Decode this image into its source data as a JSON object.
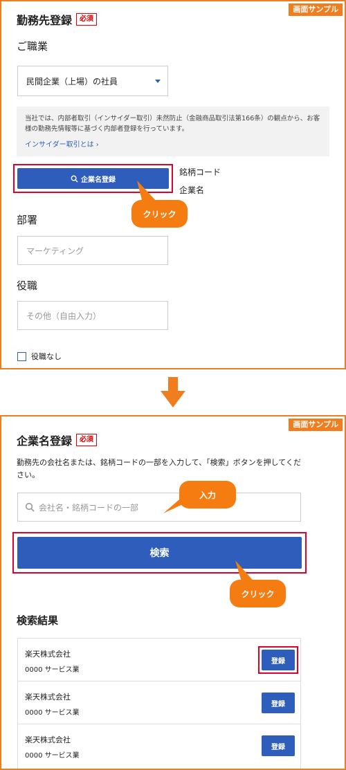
{
  "sample_label": "画面サンプル",
  "screen1": {
    "title": "勤務先登録",
    "required_badge": "必須",
    "occupation_label": "ご職業",
    "occupation_value": "民間企業（上場）の社員",
    "notice_text": "当社では、内部者取引（インサイダー取引）未然防止（金融商品取引法第166条）の観点から、お客様の勤務先情報等に基づく内部者登録を行っています。",
    "notice_link": "インサイダー取引とは",
    "company_register_button": "企業名登録",
    "stock_code_label": "銘柄コード",
    "company_name_label": "企業名",
    "callout_click": "クリック",
    "department_label": "部署",
    "department_placeholder": "マーケティング",
    "position_label": "役職",
    "position_placeholder": "その他（自由入力）",
    "no_position_label": "役職なし"
  },
  "screen2": {
    "title": "企業名登録",
    "required_badge": "必須",
    "instruction": "勤務先の会社名または、銘柄コードの一部を入力して、「検索」ボタンを押してください。",
    "search_placeholder": "会社名・銘柄コードの一部",
    "callout_input": "入力",
    "search_button": "検索",
    "callout_click": "クリック",
    "results_title": "検索結果",
    "results": [
      {
        "name": "楽天株式会社",
        "code": "0000 サービス業",
        "button": "登録"
      },
      {
        "name": "楽天株式会社",
        "code": "0000 サービス業",
        "button": "登録"
      },
      {
        "name": "楽天株式会社",
        "code": "0000 サービス業",
        "button": "登録"
      }
    ]
  },
  "colors": {
    "frame": "#f07e1e",
    "primary": "#2e5dbb",
    "highlight": "#e0002a",
    "callout": "#f57c10"
  }
}
